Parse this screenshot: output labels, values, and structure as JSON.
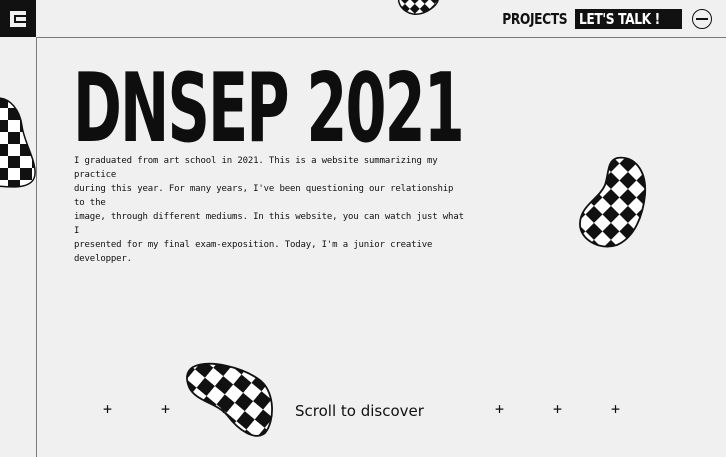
{
  "header": {
    "logo_icon": "logo-mark-icon",
    "nav_projects": "PROJECTS",
    "nav_talk": "LET'S TALK !",
    "menu_icon": "menu-minus-icon"
  },
  "hero": {
    "title": "DNSEP 2021",
    "intro_lines": [
      "I graduated from art school in 2021. This is a website summarizing my practice",
      "during this year. For many years, I've been questioning our relationship to the",
      "image, through different mediums. In this website, you can watch just what I",
      "presented for my final exam-exposition. Today, I'm a junior creative developper."
    ]
  },
  "footer": {
    "scroll_label": "Scroll to discover",
    "plus_glyph": "+"
  },
  "colors": {
    "background": "#f0f0f0",
    "ink": "#111111",
    "rule": "#7a7a7a"
  }
}
